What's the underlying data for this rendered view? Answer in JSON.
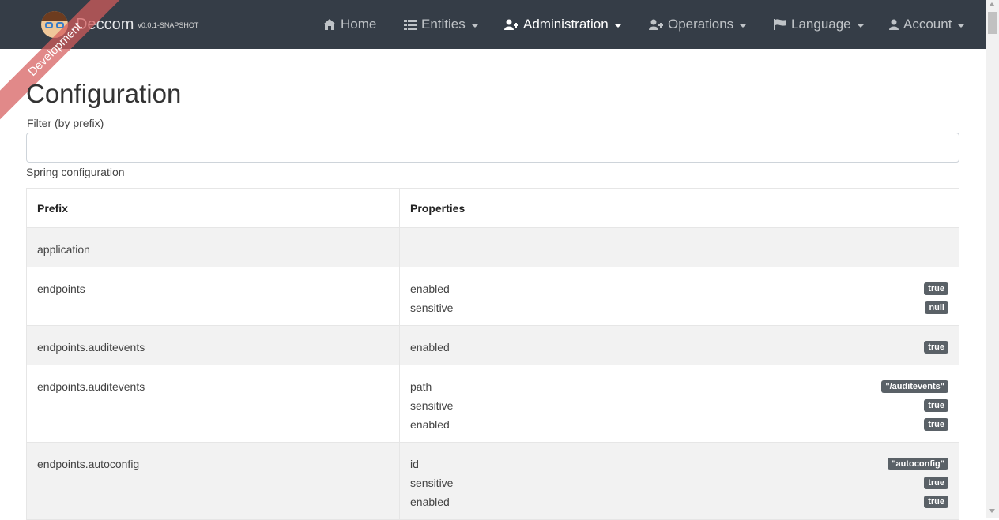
{
  "brand": {
    "name": "Deccom",
    "version": "v0.0.1-SNAPSHOT",
    "ribbon": "Development"
  },
  "nav": [
    {
      "label": "Home",
      "icon": "home-icon",
      "dropdown": false,
      "active": false
    },
    {
      "label": "Entities",
      "icon": "list-icon",
      "dropdown": true,
      "active": false
    },
    {
      "label": "Administration",
      "icon": "user-plus-icon",
      "dropdown": true,
      "active": true
    },
    {
      "label": "Operations",
      "icon": "user-plus-icon",
      "dropdown": true,
      "active": false
    },
    {
      "label": "Language",
      "icon": "flag-icon",
      "dropdown": true,
      "active": false
    },
    {
      "label": "Account",
      "icon": "user-icon",
      "dropdown": true,
      "active": false
    }
  ],
  "page": {
    "title": "Configuration",
    "filter_label": "Filter (by prefix)",
    "filter_value": "",
    "section_label": "Spring configuration"
  },
  "table": {
    "headers": {
      "prefix": "Prefix",
      "properties": "Properties"
    },
    "rows": [
      {
        "prefix": "application",
        "properties": []
      },
      {
        "prefix": "endpoints",
        "properties": [
          {
            "key": "enabled",
            "value": "true"
          },
          {
            "key": "sensitive",
            "value": "null"
          }
        ]
      },
      {
        "prefix": "endpoints.auditevents",
        "properties": [
          {
            "key": "enabled",
            "value": "true"
          }
        ]
      },
      {
        "prefix": "endpoints.auditevents",
        "properties": [
          {
            "key": "path",
            "value": "\"/auditevents\""
          },
          {
            "key": "sensitive",
            "value": "true"
          },
          {
            "key": "enabled",
            "value": "true"
          }
        ]
      },
      {
        "prefix": "endpoints.autoconfig",
        "properties": [
          {
            "key": "id",
            "value": "\"autoconfig\""
          },
          {
            "key": "sensitive",
            "value": "true"
          },
          {
            "key": "enabled",
            "value": "true"
          }
        ]
      }
    ]
  },
  "colors": {
    "navbar": "#353d47",
    "badge": "#5a6167",
    "ribbon": "#d65c5c",
    "stripe": "#f2f2f2"
  }
}
